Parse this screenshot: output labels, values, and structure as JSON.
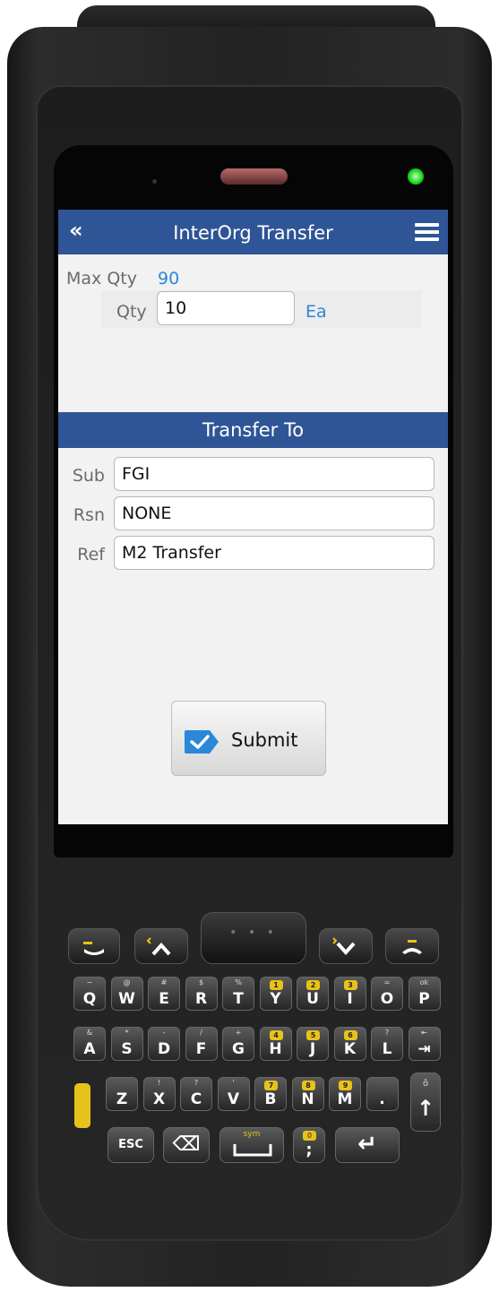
{
  "app": {
    "title": "InterOrg Transfer",
    "back_icon": "«",
    "menu_icon": "hamburger-menu-icon"
  },
  "quantity": {
    "max_label": "Max Qty",
    "max_value": "90",
    "qty_label": "Qty",
    "qty_value": "10",
    "uom": "Ea"
  },
  "transfer_to": {
    "heading": "Transfer To",
    "fields": [
      {
        "label": "Sub",
        "value": "FGI"
      },
      {
        "label": "Rsn",
        "value": "NONE"
      },
      {
        "label": "Ref",
        "value": "M2 Transfer"
      }
    ]
  },
  "actions": {
    "submit_label": "Submit"
  },
  "keypad": {
    "row1": [
      {
        "main": "Q",
        "sub": "~"
      },
      {
        "main": "W",
        "sub": "@"
      },
      {
        "main": "E",
        "sub": "#"
      },
      {
        "main": "R",
        "sub": "$"
      },
      {
        "main": "T",
        "sub": "%"
      },
      {
        "main": "Y",
        "yellow": "1"
      },
      {
        "main": "U",
        "yellow": "2"
      },
      {
        "main": "I",
        "yellow": "3"
      },
      {
        "main": "O",
        "sub": "="
      },
      {
        "main": "P",
        "sub": "ok"
      }
    ],
    "row2": [
      {
        "main": "A",
        "sub": "&"
      },
      {
        "main": "S",
        "sub": "*"
      },
      {
        "main": "D",
        "sub": "-"
      },
      {
        "main": "F",
        "sub": "/"
      },
      {
        "main": "G",
        "sub": "+"
      },
      {
        "main": "H",
        "yellow": "4"
      },
      {
        "main": "J",
        "yellow": "5"
      },
      {
        "main": "K",
        "yellow": "6"
      },
      {
        "main": "L",
        "sub": "?"
      },
      {
        "main": "⇥",
        "sub": "⇤"
      }
    ],
    "row3": [
      {
        "main": "Z",
        "sub": ""
      },
      {
        "main": "X",
        "sub": "!"
      },
      {
        "main": "C",
        "sub": "?"
      },
      {
        "main": "V",
        "sub": "'"
      },
      {
        "main": "B",
        "yellow": "7"
      },
      {
        "main": "N",
        "yellow": "8"
      },
      {
        "main": "M",
        "yellow": "9"
      },
      {
        "main": ".",
        "sub": ""
      }
    ],
    "esc_label": "ESC",
    "sym_label": "sym",
    "backspace_icon": "⌫",
    "enter_icon": "↵",
    "shift_icon": "↑",
    "zero_label": "0",
    "comma_label": ";"
  },
  "colors": {
    "header_bg": "#2f5597",
    "link_blue": "#2b87d8",
    "device_body": "#232323",
    "accent_yellow": "#e6c21b"
  }
}
